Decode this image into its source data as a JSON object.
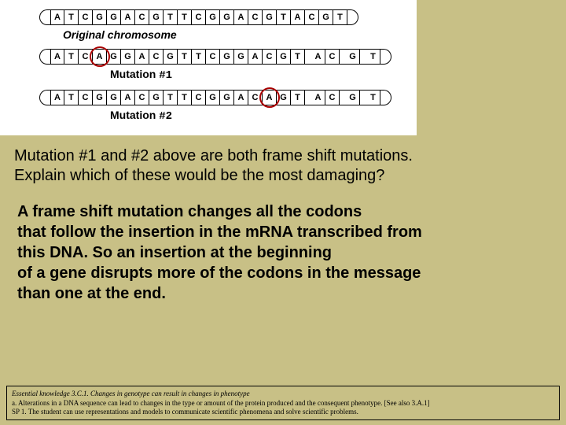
{
  "diagram": {
    "original_label": "Original chromosome",
    "mutation1_label": "Mutation",
    "mutation1_hash": "#1",
    "mutation2_label": "Mutation",
    "mutation2_hash": "#2",
    "seq_original": [
      "A",
      "T",
      "C",
      "G",
      "G",
      "A",
      "C",
      "G",
      "T",
      "T",
      "C",
      "G",
      "G",
      "A",
      "C",
      "G",
      "T",
      "A",
      "C",
      "G",
      "T"
    ],
    "seq_mut1": [
      "A",
      "T",
      "C",
      "A",
      "G",
      "G",
      "A",
      "C",
      "G",
      "T",
      "T",
      "C",
      "G",
      "G",
      "A",
      "C",
      "G",
      "T",
      "A",
      "C",
      "G",
      "T"
    ],
    "seq_mut2": [
      "A",
      "T",
      "C",
      "G",
      "G",
      "A",
      "C",
      "G",
      "T",
      "T",
      "C",
      "G",
      "G",
      "A",
      "C",
      "A",
      "G",
      "T",
      "A",
      "C",
      "G",
      "T"
    ],
    "mut1_insert_index": 3,
    "mut2_insert_index": 15
  },
  "question": {
    "line1": "Mutation #1 and #2 above are both frame shift mutations.",
    "line2": "Explain which of these would be the most damaging?"
  },
  "answer": {
    "line1": "A frame shift mutation changes all the codons",
    "line2": "that follow the insertion in the mRNA transcribed from",
    "line3": "this DNA. So an insertion at the beginning",
    "line4": "of a gene disrupts more of the codons in the message",
    "line5": "than one at the end."
  },
  "footer": {
    "ek": "Essential knowledge 3.C.1. Changes in genotype can result in changes in phenotype",
    "a": "a. Alterations in a DNA sequence can lead to changes in the type or amount of the protein produced and the consequent phenotype. [See also 3.A.1]",
    "sp": "SP 1. The student can use representations and models to communicate scientific phenomena and solve scientific problems."
  }
}
